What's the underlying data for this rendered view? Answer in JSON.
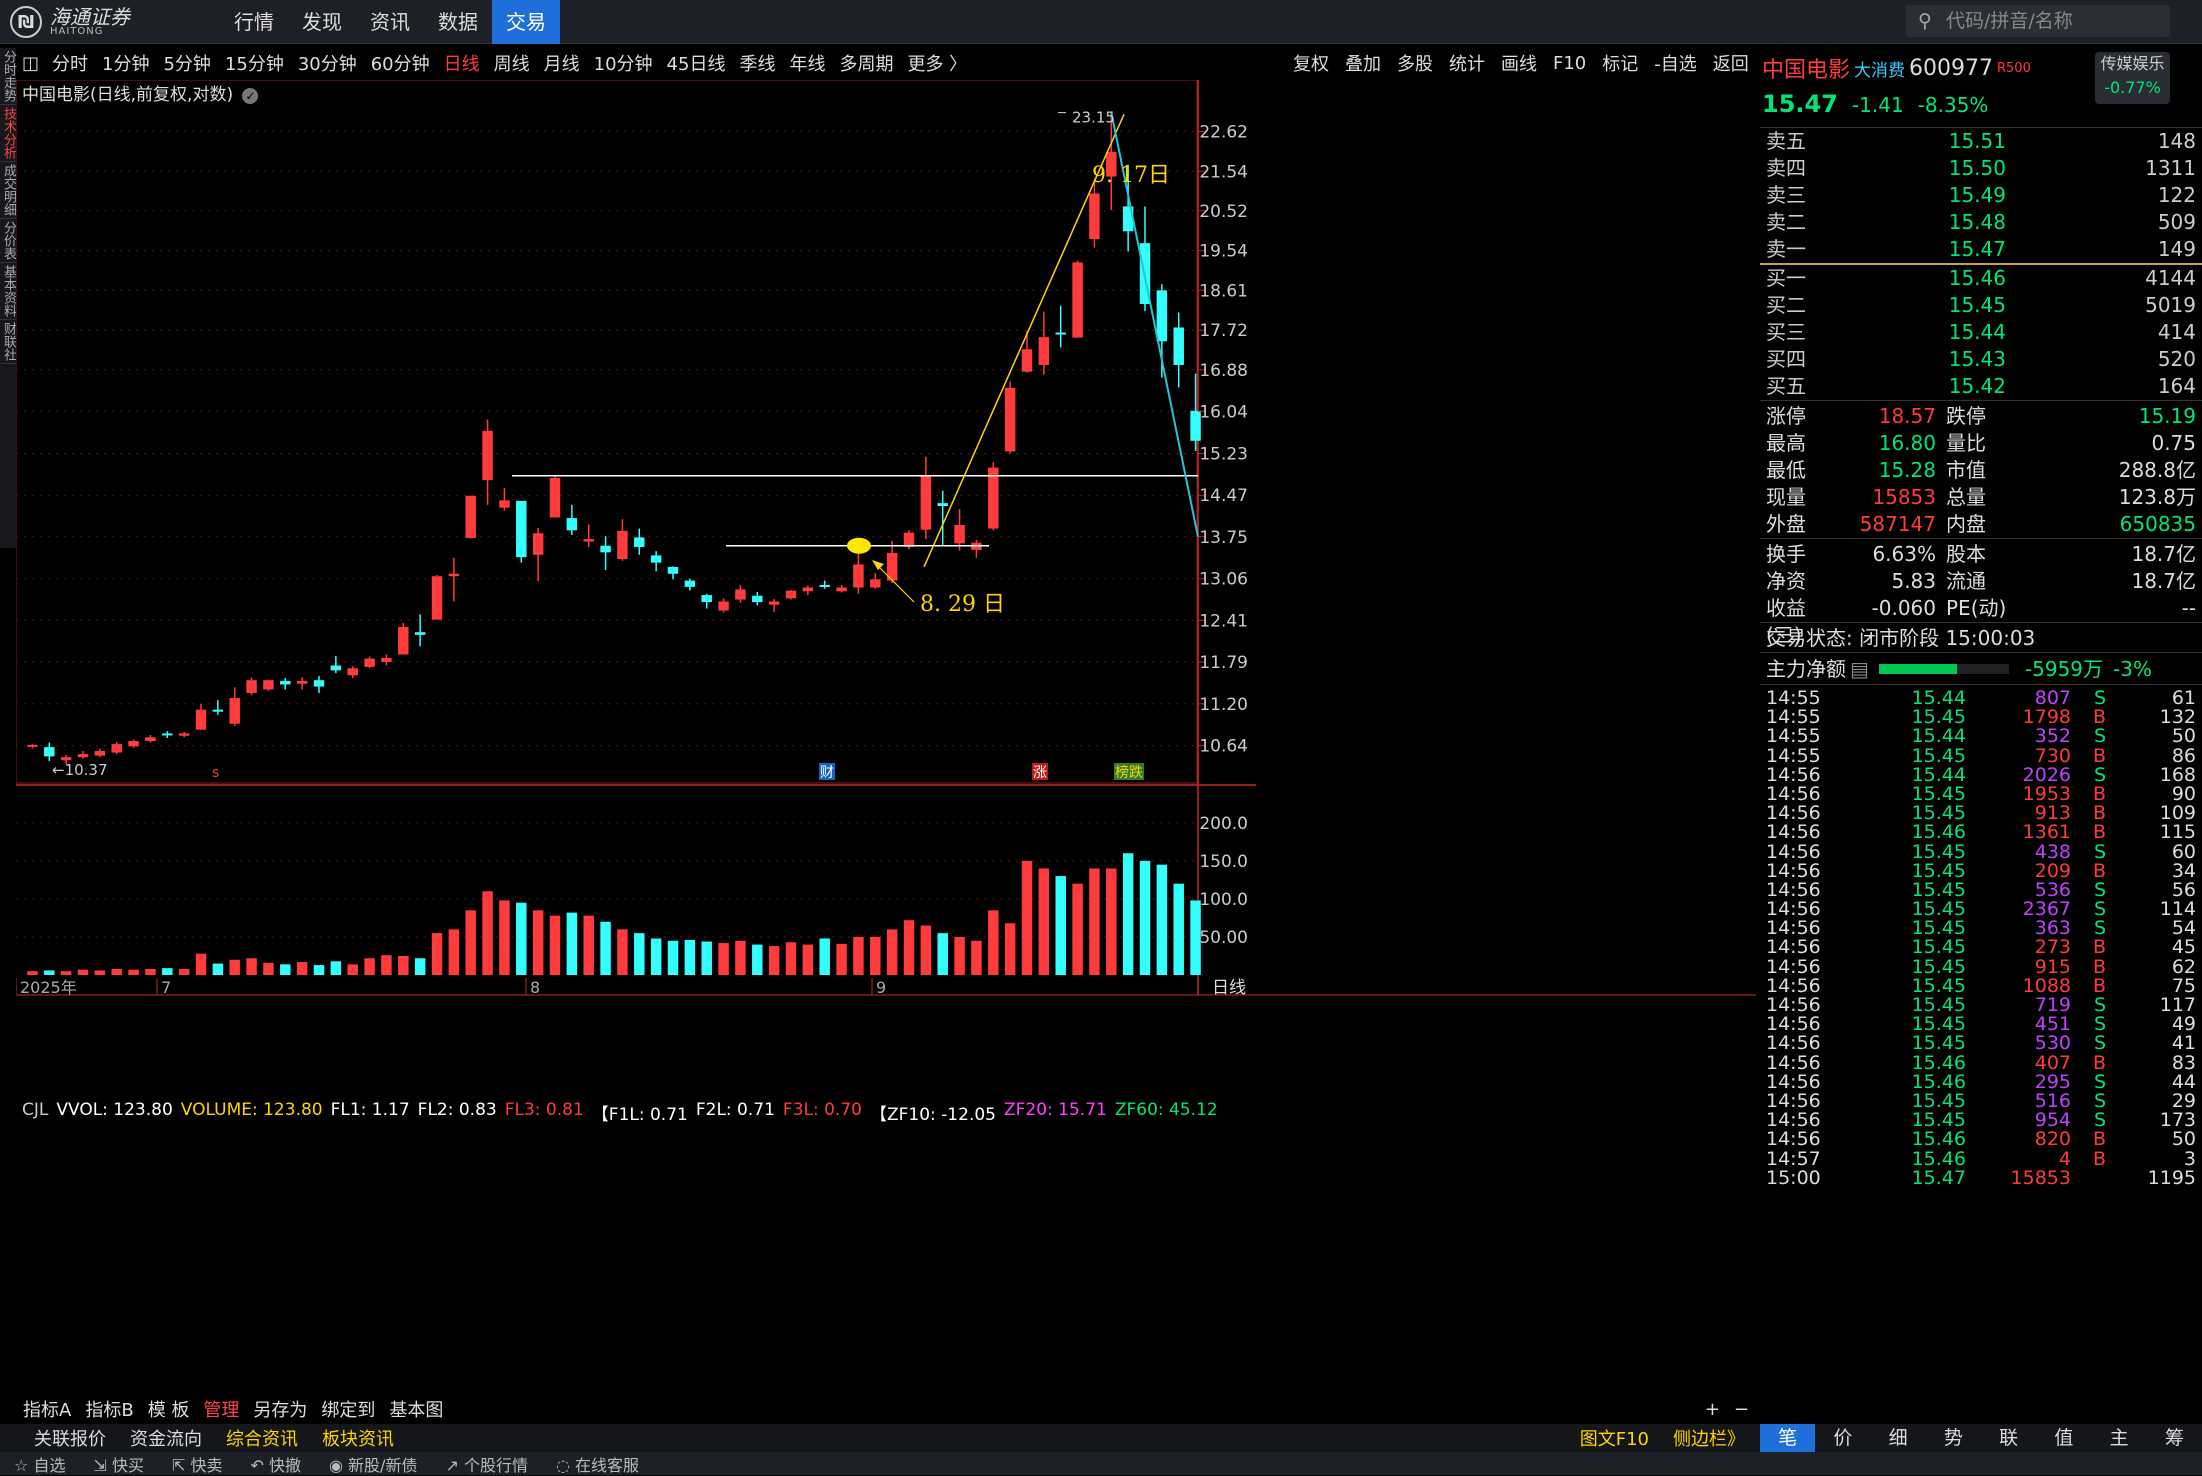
{
  "brand": {
    "name": "海通证券",
    "sub": "HAITONG"
  },
  "topnav": [
    "行情",
    "发现",
    "资讯",
    "数据",
    "交易"
  ],
  "search": {
    "placeholder": "代码/拼音/名称"
  },
  "periods": [
    "分时",
    "1分钟",
    "5分钟",
    "15分钟",
    "30分钟",
    "60分钟",
    "日线",
    "周线",
    "月线",
    "10分钟",
    "45日线",
    "季线",
    "年线",
    "多周期",
    "更多 〉"
  ],
  "active_period": "日线",
  "tools": [
    "复权",
    "叠加",
    "多股",
    "统计",
    "画线",
    "F10",
    "标记",
    "-自选",
    "返回"
  ],
  "left_tabs": [
    "分时走势",
    "技术分析",
    "成交明细",
    "分价表",
    "基本资料",
    "财联社"
  ],
  "chart_title": "中国电影(日线,前复权,对数)",
  "annotations": {
    "high": "23.15",
    "low": "←10.37",
    "date1": "9. 17日",
    "date2": "8. 29 日",
    "marker_cai": "财",
    "marker_zhang": "涨",
    "marker_bang": "榜跌",
    "marker_s": "s"
  },
  "price_axis": [
    "22.62",
    "21.54",
    "20.52",
    "19.54",
    "18.61",
    "17.72",
    "16.88",
    "16.04",
    "15.23",
    "14.47",
    "13.75",
    "13.06",
    "12.41",
    "11.79",
    "11.20",
    "10.64"
  ],
  "vol_axis": [
    "200.0",
    "150.0",
    "100.0",
    "50.00"
  ],
  "x_labels": {
    "year": "2025年",
    "m7": "7",
    "m8": "8",
    "m9": "9",
    "period": "日线"
  },
  "vol_header": [
    {
      "t": "CJL",
      "c": "#ccc"
    },
    {
      "t": "VVOL: 123.80",
      "c": "#fff"
    },
    {
      "t": "VOLUME: 123.80",
      "c": "#ffd400"
    },
    {
      "t": "FL1: 1.17",
      "c": "#fff"
    },
    {
      "t": "FL2: 0.83",
      "c": "#fff"
    },
    {
      "t": "FL3: 0.81",
      "c": "#ff3b3b"
    },
    {
      "t": "【F1L: 0.71",
      "c": "#fff"
    },
    {
      "t": "F2L: 0.71",
      "c": "#fff"
    },
    {
      "t": "F3L: 0.70",
      "c": "#ff3b3b"
    },
    {
      "t": "【ZF10: -12.05",
      "c": "#fff"
    },
    {
      "t": "ZF20: 15.71",
      "c": "#ff40ff"
    },
    {
      "t": "ZF60: 45.12",
      "c": "#00e676"
    }
  ],
  "stock": {
    "name": "中国电影",
    "tag": "大消费",
    "code": "600977",
    "rtag": "R500",
    "sector": "传媒娱乐",
    "sector_chg": "-0.77%",
    "price": "15.47",
    "chg": "-1.41",
    "pct": "-8.35%"
  },
  "asks": [
    {
      "l": "卖五",
      "p": "15.51",
      "v": "148"
    },
    {
      "l": "卖四",
      "p": "15.50",
      "v": "1311"
    },
    {
      "l": "卖三",
      "p": "15.49",
      "v": "122"
    },
    {
      "l": "卖二",
      "p": "15.48",
      "v": "509"
    },
    {
      "l": "卖一",
      "p": "15.47",
      "v": "149"
    }
  ],
  "bids": [
    {
      "l": "买一",
      "p": "15.46",
      "v": "4144"
    },
    {
      "l": "买二",
      "p": "15.45",
      "v": "5019"
    },
    {
      "l": "买三",
      "p": "15.44",
      "v": "414"
    },
    {
      "l": "买四",
      "p": "15.43",
      "v": "520"
    },
    {
      "l": "买五",
      "p": "15.42",
      "v": "164"
    }
  ],
  "stats1": [
    [
      "涨停",
      "18.57",
      "跌停",
      "15.19"
    ],
    [
      "最高",
      "16.80",
      "量比",
      "0.75"
    ],
    [
      "最低",
      "15.28",
      "市值",
      "288.8亿"
    ],
    [
      "现量",
      "15853",
      "总量",
      "123.8万"
    ],
    [
      "外盘",
      "587147",
      "内盘",
      "650835"
    ]
  ],
  "stats2": [
    [
      "换手",
      "6.63%",
      "股本",
      "18.7亿"
    ],
    [
      "净资",
      "5.83",
      "流通",
      "18.7亿"
    ],
    [
      "收益(三)",
      "-0.060",
      "PE(动)",
      "--"
    ]
  ],
  "trade_status": "交易状态: 闭市阶段 15:00:03",
  "main_flow": {
    "label": "主力净额",
    "value": "-5959万",
    "pct": "-3%",
    "fill": 0.6
  },
  "ticks": [
    [
      "14:55",
      "15.44",
      "807",
      "S",
      "61"
    ],
    [
      "14:55",
      "15.45",
      "1798",
      "B",
      "132"
    ],
    [
      "14:55",
      "15.44",
      "352",
      "S",
      "50"
    ],
    [
      "14:55",
      "15.45",
      "730",
      "B",
      "86"
    ],
    [
      "14:56",
      "15.44",
      "2026",
      "S",
      "168"
    ],
    [
      "14:56",
      "15.45",
      "1953",
      "B",
      "90"
    ],
    [
      "14:56",
      "15.45",
      "913",
      "B",
      "109"
    ],
    [
      "14:56",
      "15.46",
      "1361",
      "B",
      "115"
    ],
    [
      "14:56",
      "15.45",
      "438",
      "S",
      "60"
    ],
    [
      "14:56",
      "15.45",
      "209",
      "B",
      "34"
    ],
    [
      "14:56",
      "15.45",
      "536",
      "S",
      "56"
    ],
    [
      "14:56",
      "15.45",
      "2367",
      "S",
      "114"
    ],
    [
      "14:56",
      "15.45",
      "363",
      "S",
      "54"
    ],
    [
      "14:56",
      "15.45",
      "273",
      "B",
      "45"
    ],
    [
      "14:56",
      "15.45",
      "915",
      "B",
      "62"
    ],
    [
      "14:56",
      "15.45",
      "1088",
      "B",
      "75"
    ],
    [
      "14:56",
      "15.45",
      "719",
      "S",
      "117"
    ],
    [
      "14:56",
      "15.45",
      "451",
      "S",
      "49"
    ],
    [
      "14:56",
      "15.45",
      "530",
      "S",
      "41"
    ],
    [
      "14:56",
      "15.46",
      "407",
      "B",
      "83"
    ],
    [
      "14:56",
      "15.46",
      "295",
      "S",
      "44"
    ],
    [
      "14:56",
      "15.45",
      "516",
      "S",
      "29"
    ],
    [
      "14:56",
      "15.45",
      "954",
      "S",
      "173"
    ],
    [
      "14:56",
      "15.46",
      "820",
      "B",
      "50"
    ],
    [
      "14:57",
      "15.46",
      "4",
      "B",
      "3"
    ],
    [
      "15:00",
      "15.47",
      "15853",
      "",
      "1195"
    ]
  ],
  "bottom_tabs": [
    "指标A",
    "指标B",
    "模 板",
    "管理",
    "另存为",
    "绑定到",
    "基本图"
  ],
  "bottom_tabs2": [
    "关联报价",
    "资金流向",
    "综合资讯",
    "板块资讯"
  ],
  "bottom_right": [
    "图文F10",
    "侧边栏》"
  ],
  "right_tabs": [
    "笔",
    "价",
    "细",
    "势",
    "联",
    "值",
    "主",
    "筹"
  ],
  "statusbar": [
    "自选",
    "快买",
    "快卖",
    "快撤",
    "新股/新债",
    "个股行情",
    "在线客服"
  ],
  "chart_data": {
    "type": "candlestick",
    "title": "中国电影(日线,前复权,对数)",
    "candles": [
      [
        10.63,
        10.65,
        10.6,
        10.66
      ],
      [
        10.62,
        10.5,
        10.44,
        10.68
      ],
      [
        10.45,
        10.49,
        10.4,
        10.52
      ],
      [
        10.49,
        10.53,
        10.47,
        10.57
      ],
      [
        10.51,
        10.57,
        10.49,
        10.6
      ],
      [
        10.55,
        10.66,
        10.53,
        10.69
      ],
      [
        10.63,
        10.7,
        10.61,
        10.72
      ],
      [
        10.7,
        10.75,
        10.68,
        10.78
      ],
      [
        10.8,
        10.78,
        10.74,
        10.83
      ],
      [
        10.77,
        10.8,
        10.75,
        10.82
      ],
      [
        10.85,
        11.12,
        10.85,
        11.2
      ],
      [
        11.12,
        11.1,
        11.05,
        11.25
      ],
      [
        10.93,
        11.28,
        10.9,
        11.43
      ],
      [
        11.35,
        11.53,
        11.32,
        11.57
      ],
      [
        11.4,
        11.53,
        11.38,
        11.54
      ],
      [
        11.52,
        11.47,
        11.4,
        11.56
      ],
      [
        11.48,
        11.52,
        11.4,
        11.57
      ],
      [
        11.53,
        11.44,
        11.35,
        11.59
      ],
      [
        11.74,
        11.67,
        11.63,
        11.88
      ],
      [
        11.6,
        11.7,
        11.56,
        11.73
      ],
      [
        11.72,
        11.84,
        11.7,
        11.87
      ],
      [
        11.79,
        11.85,
        11.74,
        11.9
      ],
      [
        11.9,
        12.31,
        11.9,
        12.37
      ],
      [
        12.23,
        12.19,
        12.02,
        12.5
      ],
      [
        12.42,
        13.1,
        12.42,
        13.12
      ],
      [
        13.1,
        13.14,
        12.7,
        13.4
      ],
      [
        13.73,
        14.46,
        13.72,
        14.46
      ],
      [
        14.74,
        15.66,
        14.3,
        15.88
      ],
      [
        14.25,
        14.38,
        14.2,
        14.6
      ],
      [
        14.37,
        13.41,
        13.32,
        14.37
      ],
      [
        13.45,
        13.81,
        13.02,
        13.9
      ],
      [
        14.08,
        14.78,
        14.08,
        14.82
      ],
      [
        14.07,
        13.86,
        13.78,
        14.3
      ],
      [
        13.67,
        13.71,
        13.58,
        13.96
      ],
      [
        13.6,
        13.49,
        13.2,
        13.76
      ],
      [
        13.38,
        13.85,
        13.35,
        14.05
      ],
      [
        13.74,
        13.58,
        13.45,
        13.89
      ],
      [
        13.44,
        13.32,
        13.18,
        13.51
      ],
      [
        13.25,
        13.14,
        13.05,
        13.26
      ],
      [
        13.03,
        12.93,
        12.87,
        13.06
      ],
      [
        12.8,
        12.69,
        12.59,
        12.82
      ],
      [
        12.56,
        12.7,
        12.53,
        12.75
      ],
      [
        12.73,
        12.89,
        12.68,
        12.96
      ],
      [
        12.79,
        12.69,
        12.64,
        12.85
      ],
      [
        12.65,
        12.7,
        12.54,
        12.74
      ],
      [
        12.75,
        12.87,
        12.73,
        12.88
      ],
      [
        12.86,
        12.92,
        12.8,
        12.95
      ],
      [
        12.96,
        12.94,
        12.9,
        13.03
      ],
      [
        12.86,
        12.92,
        12.84,
        12.96
      ],
      [
        12.92,
        13.29,
        12.82,
        13.47
      ],
      [
        12.92,
        13.05,
        12.9,
        13.15
      ],
      [
        13.03,
        13.48,
        12.99,
        13.68
      ],
      [
        13.58,
        13.82,
        13.54,
        13.86
      ],
      [
        13.87,
        14.82,
        13.71,
        15.17
      ],
      [
        14.33,
        14.28,
        13.6,
        14.55
      ],
      [
        13.64,
        13.95,
        13.52,
        14.23
      ],
      [
        13.53,
        13.65,
        13.4,
        13.7
      ],
      [
        13.89,
        14.97,
        13.86,
        15.07
      ],
      [
        15.27,
        16.51,
        15.23,
        16.64
      ],
      [
        16.84,
        17.31,
        16.82,
        17.71
      ],
      [
        16.98,
        17.57,
        16.78,
        18.13
      ],
      [
        17.67,
        17.66,
        17.35,
        18.26
      ],
      [
        17.56,
        19.26,
        17.56,
        19.3
      ],
      [
        19.82,
        20.96,
        19.61,
        21.31
      ],
      [
        21.4,
        22.06,
        20.54,
        23.15
      ],
      [
        20.63,
        20.01,
        19.52,
        21.71
      ],
      [
        19.72,
        18.3,
        18.14,
        20.63
      ],
      [
        18.61,
        17.48,
        16.72,
        18.75
      ],
      [
        17.78,
        16.98,
        16.52,
        18.11
      ],
      [
        16.05,
        15.47,
        15.28,
        16.8
      ]
    ],
    "volumes": [
      5,
      6,
      5,
      7,
      6,
      8,
      7,
      8,
      9,
      8,
      28,
      15,
      20,
      22,
      16,
      14,
      17,
      13,
      18,
      14,
      22,
      26,
      25,
      22,
      55,
      60,
      85,
      110,
      98,
      95,
      85,
      78,
      82,
      78,
      70,
      60,
      55,
      48,
      45,
      46,
      44,
      42,
      45,
      40,
      38,
      43,
      40,
      48,
      41,
      50,
      50,
      60,
      72,
      65,
      55,
      50,
      45,
      85,
      68,
      150,
      140,
      130,
      120,
      140,
      140,
      160,
      150,
      145,
      120,
      98
    ],
    "price_range": [
      10.2,
      23.8
    ],
    "volume_axis": [
      "200.0",
      "150.0",
      "100.0",
      "50.00"
    ]
  }
}
